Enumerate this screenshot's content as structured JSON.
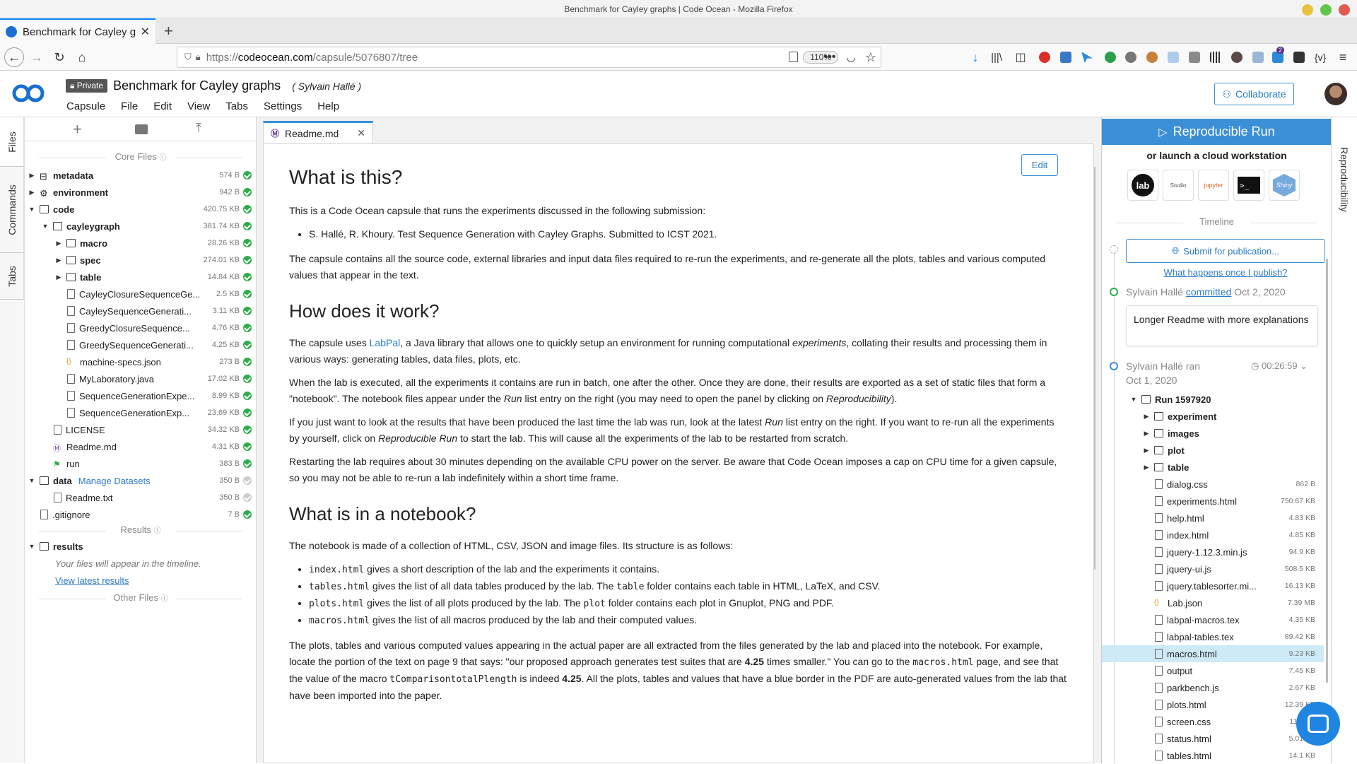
{
  "window": {
    "title": "Benchmark for Cayley graphs | Code Ocean - Mozilla Firefox"
  },
  "browser": {
    "tab_title": "Benchmark for Cayley graphs | Code Ocean",
    "url_prefix": "https://",
    "url_host": "codeocean.com",
    "url_path": "/capsule/5076807/tree",
    "zoom": "110%",
    "notification_count": "2"
  },
  "app": {
    "private_label": "Private",
    "capsule_title": "Benchmark for Cayley graphs",
    "author": "( Sylvain Hallé )",
    "menus": [
      "Capsule",
      "File",
      "Edit",
      "View",
      "Tabs",
      "Settings",
      "Help"
    ],
    "collaborate_label": "Collaborate"
  },
  "side_tabs": {
    "files": "Files",
    "commands": "Commands",
    "tabs": "Tabs",
    "reproducibility": "Reproducibility"
  },
  "file_tree": {
    "core_files_label": "Core Files",
    "results_label": "Results",
    "other_files_label": "Other Files",
    "results_folder": "results",
    "results_empty": "Your files will appear in the timeline.",
    "view_latest": "View latest results",
    "manage_datasets": "Manage Datasets",
    "items": [
      {
        "name": "metadata",
        "size": "574 B",
        "level": 0,
        "kind": "meta",
        "caret": "right",
        "bold": true
      },
      {
        "name": "environment",
        "size": "942 B",
        "level": 0,
        "kind": "env",
        "caret": "right",
        "bold": true
      },
      {
        "name": "code",
        "size": "420.75 KB",
        "level": 0,
        "kind": "folder",
        "caret": "down",
        "bold": true
      },
      {
        "name": "cayleygraph",
        "size": "381.74 KB",
        "level": 1,
        "kind": "folder",
        "caret": "down",
        "bold": true
      },
      {
        "name": "macro",
        "size": "28.26 KB",
        "level": 2,
        "kind": "folder",
        "caret": "right",
        "bold": true
      },
      {
        "name": "spec",
        "size": "274.01 KB",
        "level": 2,
        "kind": "folder",
        "caret": "right",
        "bold": true
      },
      {
        "name": "table",
        "size": "14.84 KB",
        "level": 2,
        "kind": "folder",
        "caret": "right",
        "bold": true
      },
      {
        "name": "CayleyClosureSequenceGe...",
        "size": "2.5 KB",
        "level": 2,
        "kind": "file"
      },
      {
        "name": "CayleySequenceGenerati...",
        "size": "3.11 KB",
        "level": 2,
        "kind": "file"
      },
      {
        "name": "GreedyClosureSequence...",
        "size": "4.76 KB",
        "level": 2,
        "kind": "file"
      },
      {
        "name": "GreedySequenceGenerati...",
        "size": "4.25 KB",
        "level": 2,
        "kind": "file"
      },
      {
        "name": "machine-specs.json",
        "size": "273 B",
        "level": 2,
        "kind": "json"
      },
      {
        "name": "MyLaboratory.java",
        "size": "17.02 KB",
        "level": 2,
        "kind": "file"
      },
      {
        "name": "SequenceGenerationExpe...",
        "size": "8.99 KB",
        "level": 2,
        "kind": "file"
      },
      {
        "name": "SequenceGenerationExp...",
        "size": "23.69 KB",
        "level": 2,
        "kind": "file"
      },
      {
        "name": "LICENSE",
        "size": "34.32 KB",
        "level": 1,
        "kind": "file"
      },
      {
        "name": "Readme.md",
        "size": "4.31 KB",
        "level": 1,
        "kind": "md"
      },
      {
        "name": "run",
        "size": "383 B",
        "level": 1,
        "kind": "run"
      },
      {
        "name": "data",
        "size": "350 B",
        "level": 0,
        "kind": "folder",
        "caret": "down",
        "bold": true,
        "grey": true,
        "datasets": true
      },
      {
        "name": "Readme.txt",
        "size": "350 B",
        "level": 1,
        "kind": "file",
        "grey": true
      },
      {
        "name": ".gitignore",
        "size": "7 B",
        "level": 0,
        "kind": "file"
      }
    ]
  },
  "editor": {
    "tab_label": "Readme.md",
    "edit_label": "Edit",
    "h1": "What is this?",
    "p1": "This is a Code Ocean capsule that runs the experiments discussed in the following submission:",
    "li1": "S. Hallé, R. Khoury. Test Sequence Generation with Cayley Graphs. Submitted to ICST 2021.",
    "p2": "The capsule contains all the source code, external libraries and input data files required to re-run the experiments, and re-generate all the plots, tables and various computed values that appear in the text.",
    "h2a": "How does it work?",
    "p3a": "The capsule uses ",
    "p3link": "LabPal",
    "p3b": ", a Java library that allows one to quickly setup an environment for running computational ",
    "p3em": "experiments",
    "p3c": ", collating their results and processing them in various ways: generating tables, data files, plots, etc.",
    "p4a": "When the lab is executed, all the experiments it contains are run in batch, one after the other. Once they are done, their results are exported as a set of static files that form a \"notebook\". The notebook files appear under the ",
    "p4em1": "Run",
    "p4b": " list entry on the right (you may need to open the panel by clicking on ",
    "p4em2": "Reproducibility",
    "p4c": ").",
    "p5a": "If you just want to look at the results that have been produced the last time the lab was run, look at the latest ",
    "p5em1": "Run",
    "p5b": " list entry on the right. If you want to re-run all the experiments by yourself, click on ",
    "p5em2": "Reproducible Run",
    "p5c": " to start the lab. This will cause all the experiments of the lab to be restarted from scratch.",
    "p6": "Restarting the lab requires about 30 minutes depending on the available CPU power on the server. Be aware that Code Ocean imposes a cap on CPU time for a given capsule, so you may not be able to re-run a lab indefinitely within a short time frame.",
    "h2b": "What is in a notebook?",
    "p7": "The notebook is made of a collection of HTML, CSV, JSON and image files. Its structure is as follows:",
    "l1code": "index.html",
    "l1": " gives a short description of the lab and the experiments it contains.",
    "l2code": "tables.html",
    "l2a": " gives the list of all data tables produced by the lab. The ",
    "l2code2": "table",
    "l2b": " folder contains each table in HTML, LaTeX, and CSV.",
    "l3code": "plots.html",
    "l3a": " gives the list of all plots produced by the lab. The ",
    "l3code2": "plot",
    "l3b": " folder contains each plot in Gnuplot, PNG and PDF.",
    "l4code": "macros.html",
    "l4": " gives the list of all macros produced by the lab and their computed values.",
    "p8a": "The plots, tables and various computed values appearing in the actual paper are all extracted from the files generated by the lab and placed into the notebook. For example, locate the portion of the text on page 9 that says: \"our proposed approach generates test suites that are ",
    "p8b1": "4.25",
    "p8b": " times smaller.\" You can go to the ",
    "p8code": "macros.html",
    "p8c": " page, and see that the value of the macro ",
    "p8code2": "tComparisontotalPlength",
    "p8d": " is indeed ",
    "p8b2": "4.25",
    "p8e": ". All the plots, tables and values that have a blue border in the PDF are auto-generated values from the lab that have been imported into the paper."
  },
  "right_panel": {
    "run_label": "Reproducible Run",
    "launch_label": "or launch a cloud workstation",
    "workstations": [
      "lab",
      "Studio",
      "jupyter",
      ">_",
      "Shiny"
    ],
    "timeline_label": "Timeline",
    "submit_label": "Submit for publication...",
    "what_happens": "What happens once I publish?",
    "commit_author": "Sylvain Hallé",
    "commit_verb": "committed",
    "commit_date": "Oct 2, 2020",
    "commit_msg": "Longer Readme with more explanations",
    "ran_author": "Sylvain Hallé ran",
    "ran_duration": "00:26:59",
    "ran_date": "Oct 1, 2020",
    "run_folder": "Run 1597920",
    "items": [
      {
        "name": "experiment",
        "kind": "folder",
        "size": ""
      },
      {
        "name": "images",
        "kind": "folder",
        "size": ""
      },
      {
        "name": "plot",
        "kind": "folder",
        "size": ""
      },
      {
        "name": "table",
        "kind": "folder",
        "size": ""
      },
      {
        "name": "dialog.css",
        "kind": "file",
        "size": "862 B"
      },
      {
        "name": "experiments.html",
        "kind": "file",
        "size": "750.67 KB"
      },
      {
        "name": "help.html",
        "kind": "file",
        "size": "4.83 KB"
      },
      {
        "name": "index.html",
        "kind": "file",
        "size": "4.85 KB"
      },
      {
        "name": "jquery-1.12.3.min.js",
        "kind": "file",
        "size": "94.9 KB"
      },
      {
        "name": "jquery-ui.js",
        "kind": "file",
        "size": "508.5 KB"
      },
      {
        "name": "jquery.tablesorter.mi...",
        "kind": "file",
        "size": "16.13 KB"
      },
      {
        "name": "Lab.json",
        "kind": "json",
        "size": "7.39 MB"
      },
      {
        "name": "labpal-macros.tex",
        "kind": "file",
        "size": "4.35 KB"
      },
      {
        "name": "labpal-tables.tex",
        "kind": "file",
        "size": "89.42 KB"
      },
      {
        "name": "macros.html",
        "kind": "file",
        "size": "9.23 KB",
        "selected": true
      },
      {
        "name": "output",
        "kind": "file",
        "size": "7.45 KB"
      },
      {
        "name": "parkbench.js",
        "kind": "file",
        "size": "2.67 KB"
      },
      {
        "name": "plots.html",
        "kind": "file",
        "size": "12.39 KB"
      },
      {
        "name": "screen.css",
        "kind": "file",
        "size": "11.5 KB"
      },
      {
        "name": "status.html",
        "kind": "file",
        "size": "5.01 KB"
      },
      {
        "name": "tables.html",
        "kind": "file",
        "size": "14.1 KB"
      }
    ]
  },
  "colors": {
    "accent": "#3b8fd6",
    "ok": "#2eac4a",
    "selected_row": "#cfeaf7",
    "firefox_blue": "#0a84ff"
  }
}
